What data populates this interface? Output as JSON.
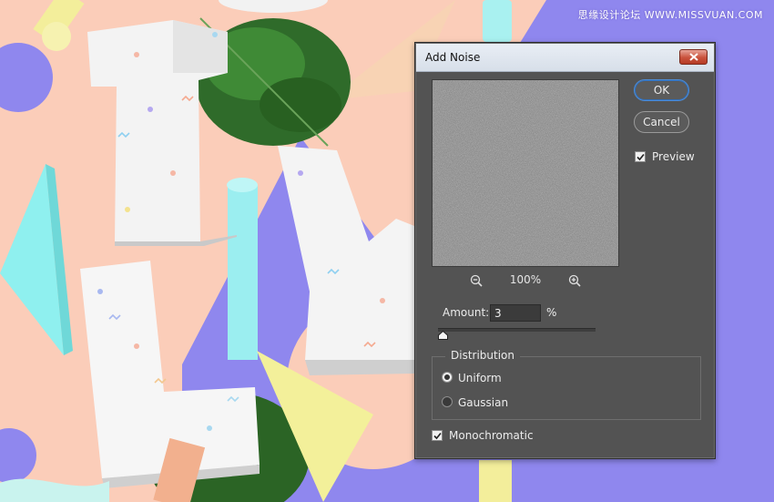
{
  "watermark": "思缘设计论坛 WWW.MISSVUAN.COM",
  "dialog": {
    "title": "Add Noise",
    "ok_label": "OK",
    "cancel_label": "Cancel",
    "preview_label": "Preview",
    "preview_checked": true,
    "zoom_level": "100%",
    "amount_label": "Amount:",
    "amount_value": "3",
    "amount_unit": "%",
    "amount_slider_fraction": 0.03,
    "distribution": {
      "title": "Distribution",
      "options": [
        {
          "label": "Uniform",
          "selected": true
        },
        {
          "label": "Gaussian",
          "selected": false
        }
      ]
    },
    "monochromatic_label": "Monochromatic",
    "monochromatic_checked": true
  },
  "icons": {
    "close": "close-icon",
    "zoom_out": "zoom-out-icon",
    "zoom_in": "zoom-in-icon",
    "checkmark": "checkmark-icon",
    "slider_thumb": "slider-thumb-icon"
  },
  "colors": {
    "background_purple": "#8f87ee",
    "background_peach": "#fbcdb9",
    "dialog_body": "#535353",
    "ok_focus": "#4d8cd6",
    "close_red": "#c9523c"
  }
}
